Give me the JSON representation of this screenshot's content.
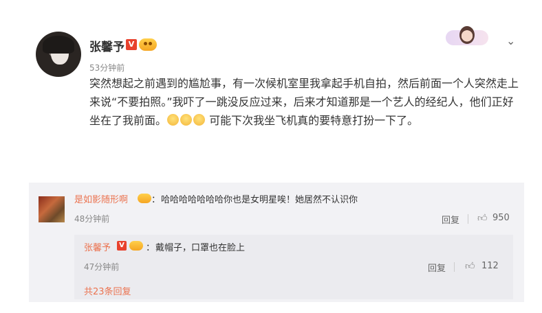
{
  "post": {
    "username": "张馨予",
    "verified_badge": "V",
    "timestamp": "53分钟前",
    "text_part1": "突然想起之前遇到的尴尬事，有一次候机室里我拿起手机自拍，然后前面一个人突然走上来说“不要拍照。”我吓了一跳没反应过来，后来才知道那是一个艺人的经纪人，他们正好坐在了我前面。",
    "text_part2": "可能下次我坐飞机真的要特意打扮一下了。",
    "dropdown_icon": "chevron-down-icon"
  },
  "comment": {
    "username": "是如影随形啊",
    "colon": "：",
    "text": "哈哈哈哈哈哈哈你也是女明星唉！她居然不认识你",
    "timestamp": "48分钟前",
    "reply_label": "回复",
    "like_icon": "thumbs-up-icon",
    "like_count": "950"
  },
  "reply": {
    "username": "张馨予",
    "verified_badge": "V",
    "colon": "：",
    "text": "戴帽子，口罩也在脸上",
    "timestamp": "47分钟前",
    "reply_label": "回复",
    "like_icon": "thumbs-up-icon",
    "like_count": "112",
    "more_replies": "共23条回复"
  },
  "colors": {
    "accent_orange": "#eb7350",
    "verified_red": "#e8412d",
    "comment_bg": "#f2f2f5",
    "reply_bg": "#ebebef"
  }
}
